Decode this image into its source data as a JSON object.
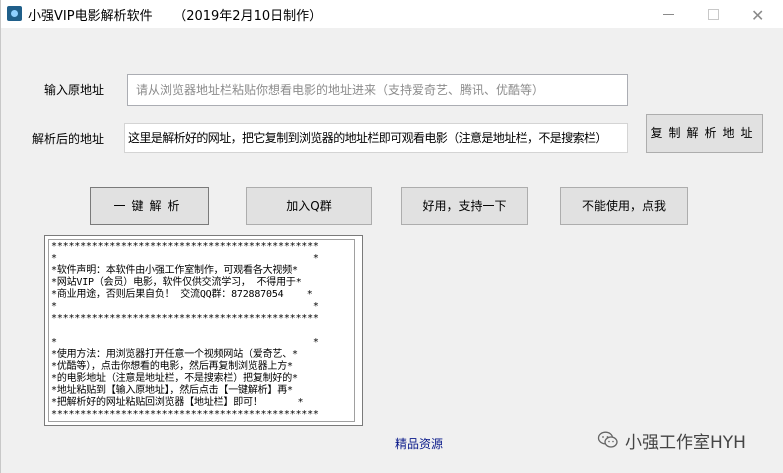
{
  "window": {
    "title": "小强VIP电影解析软件     （2019年2月10日制作）",
    "minimize_label": "—",
    "maximize_label": "☐",
    "close_label": "✕",
    "app_icon": "app-film-icon"
  },
  "form": {
    "source_url_label": "输入原地址",
    "source_url_placeholder": "请从浏览器地址栏粘贴你想看电影的地址进来（支持爱奇艺、腾讯、优酷等）",
    "parsed_url_label": "解析后的地址",
    "parsed_url_value": "这里是解析好的网址，把它复制到浏览器的地址栏即可观看电影（注意是地址栏，不是搜索栏）"
  },
  "buttons": {
    "copy_parsed": "复制解析地址",
    "one_click_parse": "一键解析",
    "join_qq_group": "加入Q群",
    "support": "好用，支持一下",
    "report_broken": "不能使用，点我"
  },
  "info_box": {
    "lines": [
      "**********************************************",
      "*                                            *",
      "*软件声明：本软件由小强工作室制作，可观看各大视频*",
      "*网站VIP（会员）电影，软件仅供交流学习， 不得用于*",
      "*商业用途，否则后果自负！ 交流QQ群：872887054    *",
      "*                                            *",
      "**********************************************",
      "",
      "*                                            *",
      "*使用方法：用浏览器打开任意一个视频网站（爱奇艺、*",
      "*优酷等），点击你想看的电影，然后再复制浏览器上方*",
      "*的电影地址（注意是地址栏，不是搜索栏）把复制好的*",
      "*地址粘贴到【输入原地址】，然后点击【一键解析】再*",
      "*把解析好的网址粘贴回浏览器【地址栏】即可！      *",
      "**********************************************"
    ]
  },
  "footer": {
    "resource_link": "精品资源",
    "watermark_text": "小强工作室HYH",
    "watermark_icon": "wechat-icon"
  }
}
